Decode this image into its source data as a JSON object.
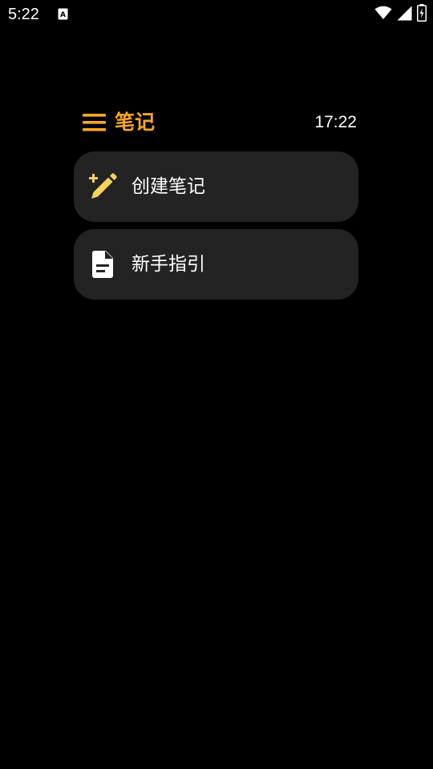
{
  "status_bar": {
    "time": "5:22",
    "icons": [
      "autofill-a-icon",
      "wifi-icon",
      "signal-icon",
      "battery-charging-icon"
    ]
  },
  "header": {
    "menu_icon": "hamburger-menu-icon",
    "title": "笔记",
    "clock": "17:22"
  },
  "menu_items": [
    {
      "label": "创建笔记",
      "icon": "magic-pencil-icon"
    },
    {
      "label": "新手指引",
      "icon": "document-icon"
    }
  ],
  "colors": {
    "background": "#000000",
    "accent": "#f5a623",
    "card": "#232323",
    "icon_yellow": "#f7d25c",
    "text": "#ffffff"
  }
}
